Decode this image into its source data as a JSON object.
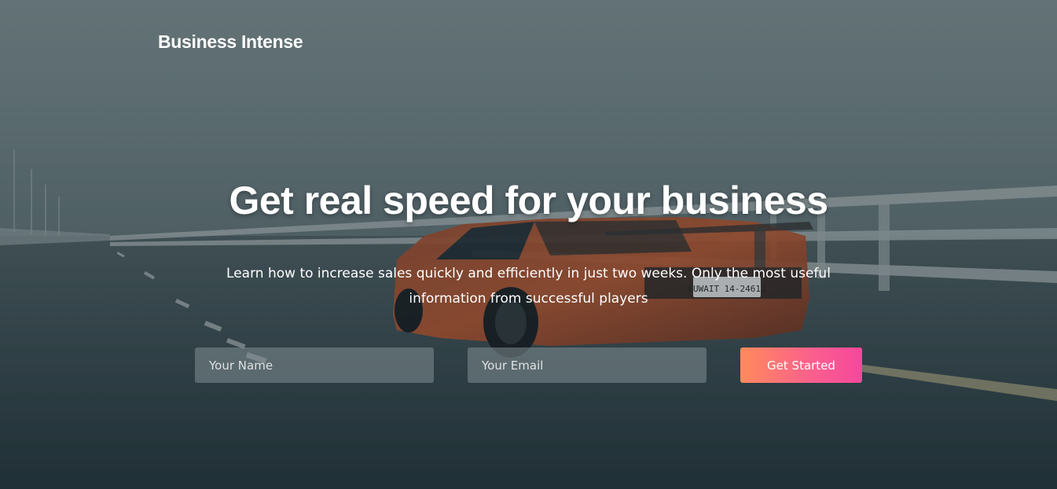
{
  "brand": {
    "name": "Business Intense"
  },
  "hero": {
    "headline": "Get real speed for your business",
    "subtext": "Learn how to increase sales quickly and efficiently in just two weeks. Only the most useful information from successful players"
  },
  "form": {
    "name_placeholder": "Your Name",
    "email_placeholder": "Your Email",
    "submit_label": "Get Started"
  },
  "background": {
    "plate_text": "KUWAIT 14-24611"
  },
  "colors": {
    "cta_start": "#ff8a5c",
    "cta_end": "#f6479d",
    "text": "#ffffff"
  }
}
